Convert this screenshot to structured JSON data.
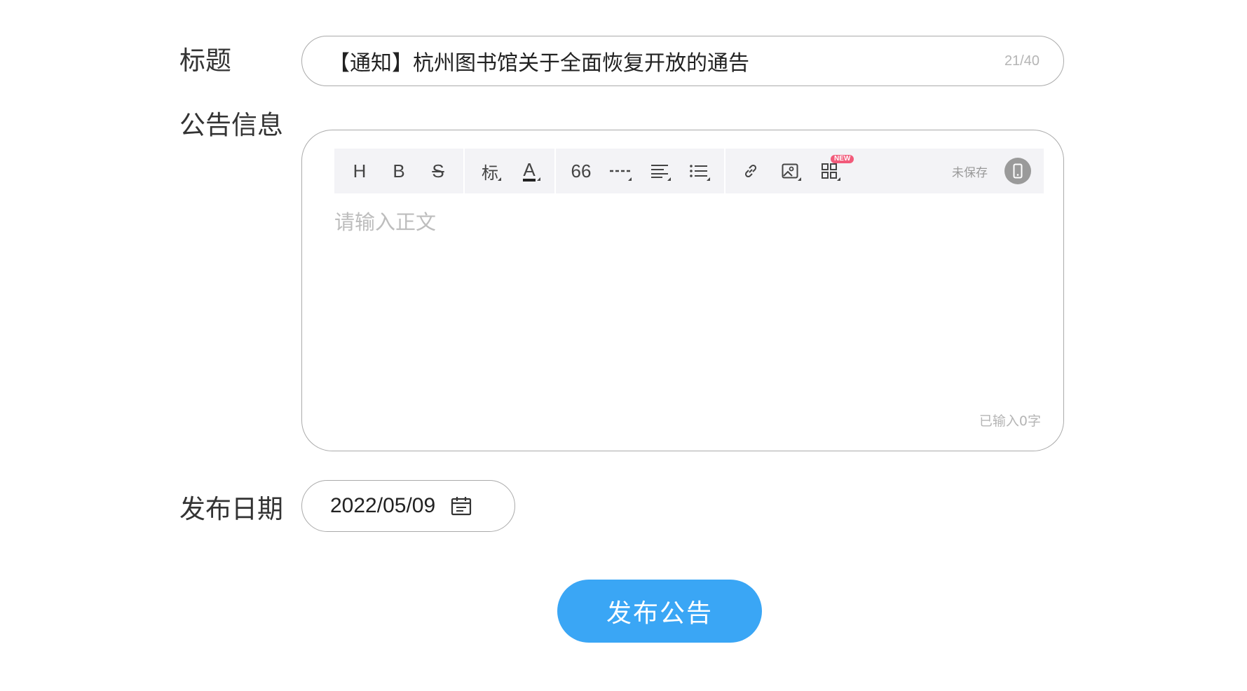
{
  "form": {
    "title_label": "标题",
    "title_value": "【通知】杭州图书馆关于全面恢复开放的通告",
    "title_count": "21/40",
    "content_label": "公告信息",
    "date_label": "发布日期",
    "date_value": "2022/05/09",
    "publish_button": "发布公告"
  },
  "editor": {
    "toolbar": {
      "heading": "H",
      "bold": "B",
      "strike": "S",
      "style": "标",
      "font_color": "A",
      "quote": "66",
      "new_badge": "NEW",
      "save_status": "未保存"
    },
    "placeholder": "请输入正文",
    "word_count": "已输入0字"
  },
  "colors": {
    "accent": "#3aa6f5",
    "badge": "#f25a7a",
    "border": "#aaaaaa",
    "placeholder": "#bdbdbd"
  },
  "icons": [
    "heading-icon",
    "bold-icon",
    "strikethrough-icon",
    "style-icon",
    "font-color-icon",
    "quote-icon",
    "divider-icon",
    "align-icon",
    "list-icon",
    "link-icon",
    "image-icon",
    "template-icon",
    "phone-preview-icon",
    "calendar-icon"
  ]
}
